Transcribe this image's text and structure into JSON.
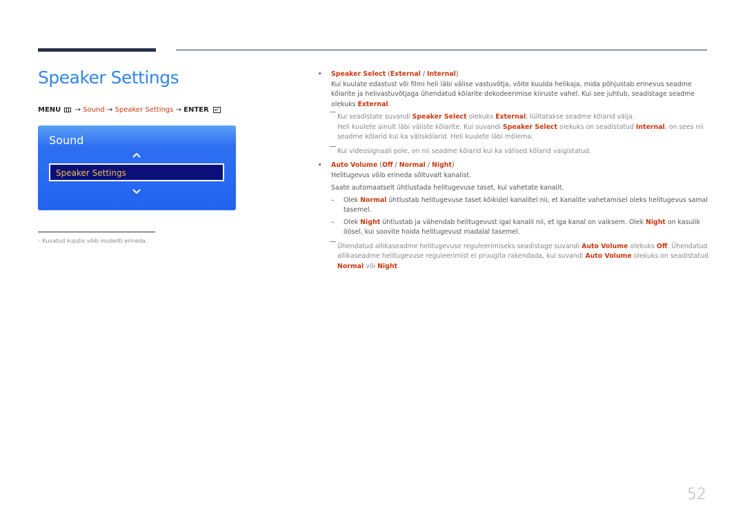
{
  "page": {
    "title": "Speaker Settings",
    "page_number": "52"
  },
  "menu_path": {
    "menu": "MENU",
    "arrow": "→",
    "sound": "Sound",
    "speaker_settings": "Speaker Settings",
    "enter": "ENTER",
    "enter_icon": "↵"
  },
  "osd": {
    "title": "Sound",
    "selected_item": "Speaker Settings",
    "up_icon": "chevron-up",
    "down_icon": "chevron-down"
  },
  "footnote": "–  Kuvatud kujutis võib mudeliti erineda.",
  "speaker_select": {
    "name": "Speaker Select",
    "opt1": "External",
    "opt2": "Internal",
    "desc_a": "Kui kuulate edastust või filmi heli läbi välise vastuvõtja, võite kuulda helikaja, mida põhjustab erinevus seadme kõlarite ja helivastuvõtjaga ühendatud kõlarite dekodeerimise kiiruste vahel. Kui see juhtub, seadistage seadme olekuks ",
    "desc_b": "External",
    "desc_c": ".",
    "note1_a": "Kui seadistate suvandi ",
    "note1_b": "Speaker Select",
    "note1_c": " olekuks ",
    "note1_d": "External",
    "note1_e": ", lülitatakse seadme kõlarid välja.",
    "note1s_a": "Heli kuulete ainult läbi väliste kõlarite. Kui suvandi ",
    "note1s_b": "Speaker Select",
    "note1s_c": " olekuks on seadistatud ",
    "note1s_d": "Internal",
    "note1s_e": ", on sees nii seadme kõlarid kui ka väliskõlarid. Heli kuulete läbi mõlema.",
    "note2": "Kui videosignaali pole, on nii seadme kõlarid kui ka välised kõlarid vaigistatud."
  },
  "auto_volume": {
    "name": "Auto Volume",
    "opt1": "Off",
    "opt2": "Normal",
    "opt3": "Night",
    "desc1": "Helitugevus võib erineda sõltuvalt kanalist.",
    "desc2": "Saate automaatselt ühtlustada helitugevuse taset, kui vahetate kanalit.",
    "d1_a": "Olek ",
    "d1_b": "Normal",
    "d1_c": " ühtlustab helitugevuse taset kõikidel kanalitel nii, et kanalite vahetamisel oleks helitugevus samal tasemel.",
    "d2_a": "Olek ",
    "d2_b": "Night",
    "d2_c": " ühtlustab ja vähendab helitugevust igal kanalil nii, et iga kanal on vaiksem. Olek ",
    "d2_d": "Night",
    "d2_e": " on kasulik öösel, kui soovite hoida helitugevust madalal tasemel.",
    "note_a": "Ühendatud allikaseadme helitugevuse reguleerimiseks seadistage suvandi ",
    "note_b": "Auto Volume",
    "note_c": " olekuks ",
    "note_d": "Off",
    "note_e": ". Ühendatud allikaseadme helitugevuse reguleerimist ei pruugita rakendada, kui suvandi ",
    "note_f": "Auto Volume",
    "note_g": " olekuks on seadistatud ",
    "note_h": "Normal",
    "note_i": " või ",
    "note_j": "Night",
    "note_k": "."
  },
  "colors": {
    "title_blue": "#2f86e8",
    "accent_red": "#c9380f",
    "osd_blue": "#2264f0",
    "osd_selected": "#0a0f7a",
    "osd_selected_text": "#f0c040"
  }
}
